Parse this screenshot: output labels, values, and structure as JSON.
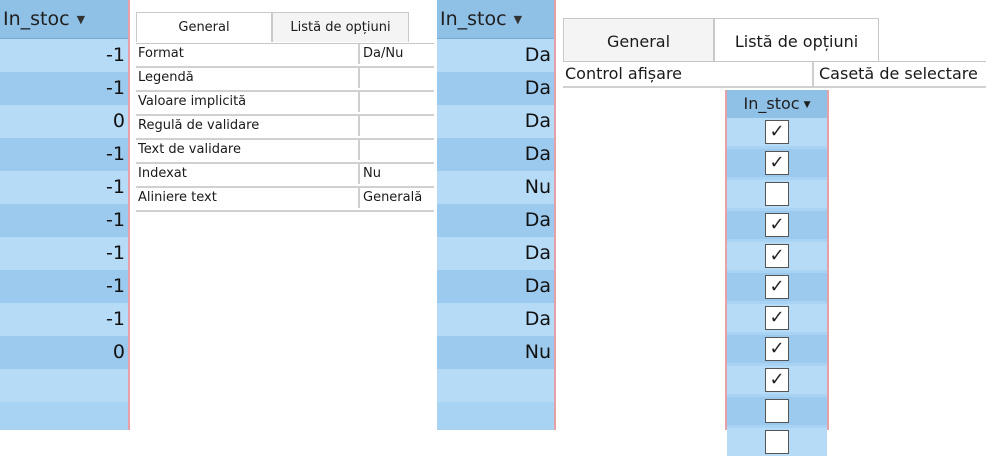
{
  "datasheet1": {
    "header": "In_stoc",
    "values": [
      "-1",
      "-1",
      "0",
      "-1",
      "-1",
      "-1",
      "-1",
      "-1",
      "-1",
      "0",
      ""
    ]
  },
  "property_sheet": {
    "tabs": [
      "General",
      "Listă de opțiuni"
    ],
    "active_tab": "General",
    "rows": [
      {
        "label": "Format",
        "value": "Da/Nu"
      },
      {
        "label": "Legendă",
        "value": ""
      },
      {
        "label": "Valoare implicită",
        "value": ""
      },
      {
        "label": "Regulă de validare",
        "value": ""
      },
      {
        "label": "Text de validare",
        "value": ""
      },
      {
        "label": "Indexat",
        "value": "Nu"
      },
      {
        "label": "Aliniere text",
        "value": "Generală"
      }
    ]
  },
  "datasheet2": {
    "header": "In_stoc",
    "values": [
      "Da",
      "Da",
      "Da",
      "Da",
      "Nu",
      "Da",
      "Da",
      "Da",
      "Da",
      "Nu",
      ""
    ]
  },
  "lookup_sheet": {
    "tabs": [
      "General",
      "Listă de opțiuni"
    ],
    "active_tab": "Listă de opțiuni",
    "row": {
      "label": "Control afișare",
      "value": "Casetă de selectare"
    }
  },
  "checkbox_column": {
    "header": "In_stoc",
    "checked": [
      true,
      true,
      false,
      true,
      true,
      true,
      true,
      true,
      true,
      false
    ]
  },
  "icons": {
    "dropdown": "chevron-down-icon",
    "check": "check-icon"
  }
}
